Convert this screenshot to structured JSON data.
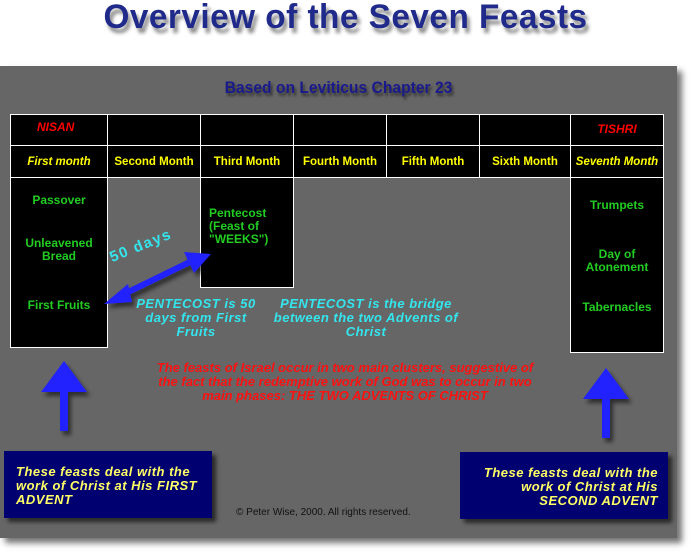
{
  "title": "Overview of the Seven Feasts",
  "subtitle": "Based on Leviticus Chapter 23",
  "months": {
    "hebrew_first": "NISAN",
    "hebrew_seventh": "TISHRI",
    "names": [
      "First month",
      "Second Month",
      "Third Month",
      "Fourth Month",
      "Fifth Month",
      "Sixth Month",
      "Seventh Month"
    ]
  },
  "feasts": {
    "spring": [
      "Passover",
      "Unleavened Bread",
      "First Fruits"
    ],
    "summer": "Pentecost (Feast of \"WEEKS\")",
    "fall": [
      "Trumpets",
      "Day of Atonement",
      "Tabernacles"
    ]
  },
  "annotations": {
    "fifty_days": "50 days",
    "pentecost_from": "PENTECOST is 50 days from First Fruits",
    "pentecost_bridge": "PENTECOST is the bridge between the two Advents of Christ",
    "clusters": "The feasts of Israel occur in two main clusters, suggestive of the fact that the redemptive work of God was to occur in two main phases: THE TWO ADVENTS OF CHRIST"
  },
  "advents": {
    "first": "These feasts deal with the work of Christ at His FIRST ADVENT",
    "second": "These feasts deal with the work of Christ at His SECOND ADVENT"
  },
  "copyright": "© Peter Wise, 2000.  All rights reserved.",
  "colors": {
    "panel": "#666666",
    "title": "#1f2a8a",
    "month_label": "#ffff00",
    "hebrew_month": "#ff0000",
    "feast_text": "#22cc22",
    "annotation": "#33e6ee",
    "arrow": "#2222ff",
    "advent_box": "#000070"
  }
}
